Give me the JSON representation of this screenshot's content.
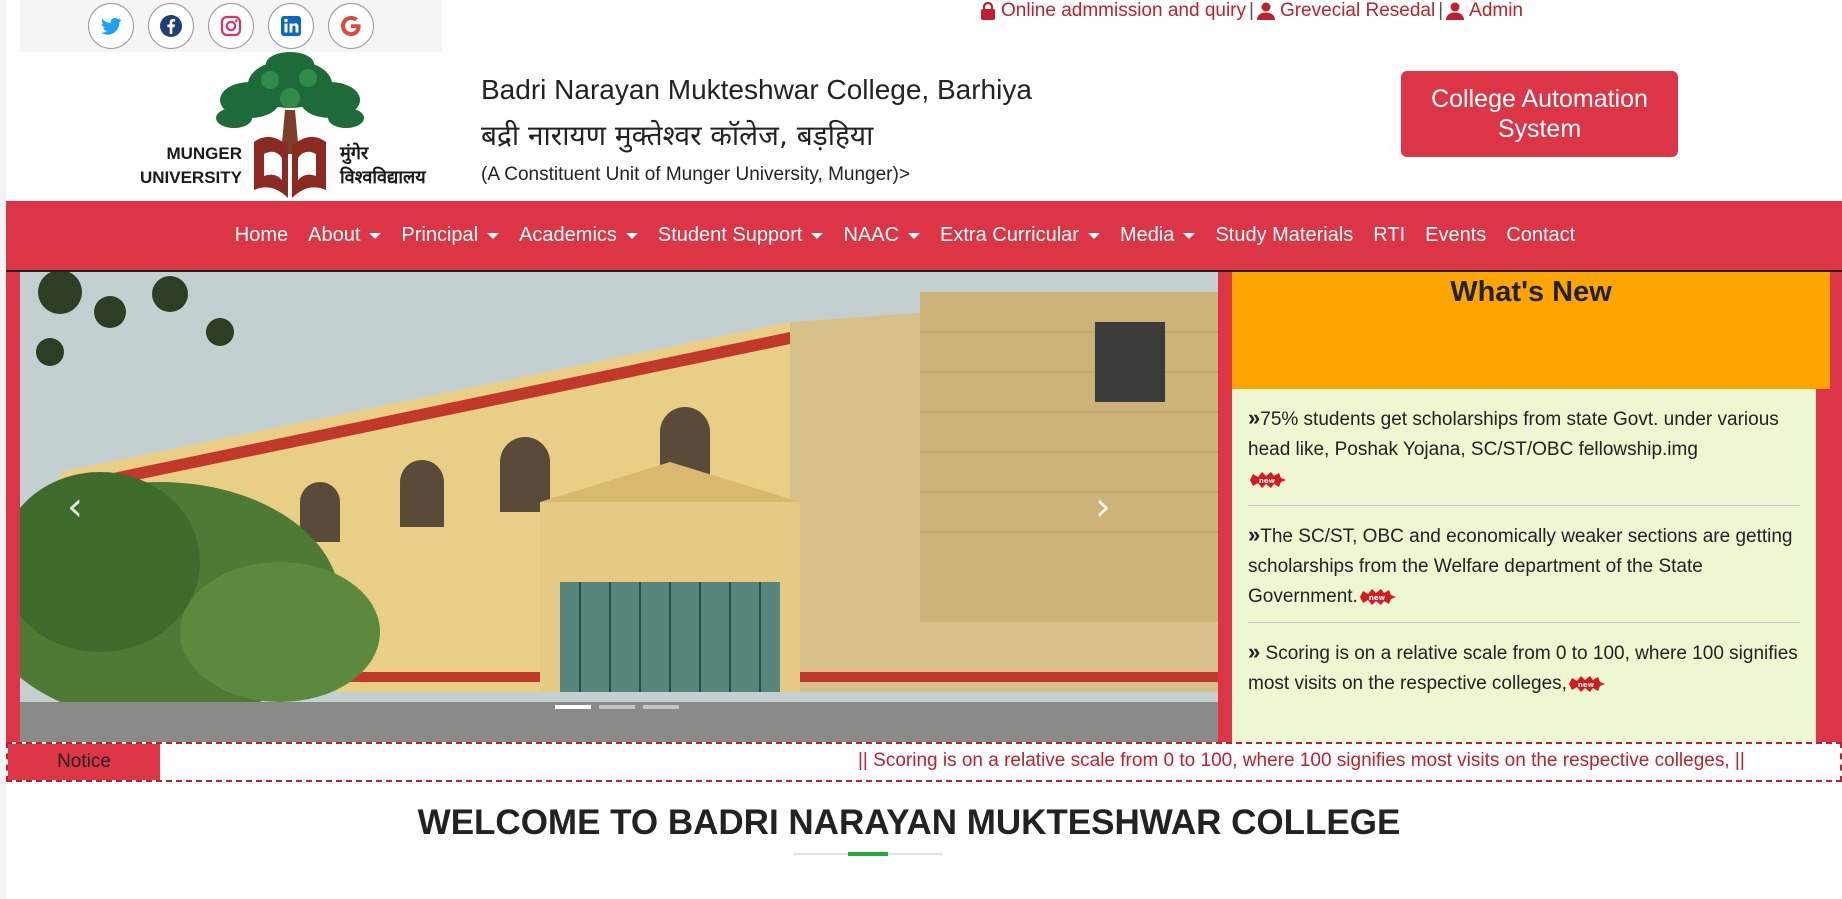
{
  "social": [
    {
      "name": "twitter-icon",
      "color": "#1da1f2"
    },
    {
      "name": "facebook-icon",
      "color": "#1877f2"
    },
    {
      "name": "instagram-icon",
      "color": "#e1306c"
    },
    {
      "name": "linkedin-icon",
      "color": "#0a66c2"
    },
    {
      "name": "google-icon",
      "color": "#db4437"
    }
  ],
  "top_links": {
    "admission": "Online admmission and quiry",
    "grievance": "Grevecial Resedal",
    "admin": "Admin",
    "separator": "|"
  },
  "header": {
    "university_en": "MUNGER UNIVERSITY",
    "university_hi": "मुंगेर विश्वविद्यालय",
    "college_en": "Badri Narayan Mukteshwar College, Barhiya",
    "college_hi": "बद्री नारायण मुक्तेश्वर कॉलेज, बड़हिया",
    "college_unit": "(A Constituent Unit of Munger University, Munger)>",
    "automation_button": "College Automation System"
  },
  "nav": {
    "home": "Home",
    "about": "About",
    "principal": "Principal",
    "academics": "Academics",
    "student_support": "Student Support",
    "naac": "NAAC",
    "extra_curricular": "Extra Curricular",
    "media": "Media",
    "study_materials": "Study Materials",
    "rti": "RTI",
    "events": "Events",
    "contact": "Contact"
  },
  "carousel": {
    "prev": "‹",
    "next": "›",
    "slide_count": 3,
    "active_slide": 1
  },
  "whats_new": {
    "title": "What's New",
    "items": [
      "75% students get scholarships from state Govt. under various head like, Poshak Yojana, SC/ST/OBC fellowship.img",
      "The SC/ST, OBC and economically weaker sections are getting scholarships from the Welfare department of the State Government.",
      " Scoring is on a relative scale from 0 to 100, where 100 signifies most visits on the respective colleges,"
    ],
    "bullet": "»",
    "badge": "new"
  },
  "notice": {
    "label": "Notice",
    "text": "|| Scoring is on a relative scale from 0 to 100, where 100 signifies most visits on the respective colleges, ||"
  },
  "welcome": {
    "title": "WELCOME TO BADRI NARAYAN MUKTESHWAR COLLEGE"
  },
  "colors": {
    "primary_red": "#dc3545",
    "orange": "#ffa500",
    "light_green": "#edf7d2",
    "accent_green": "#28a745"
  }
}
